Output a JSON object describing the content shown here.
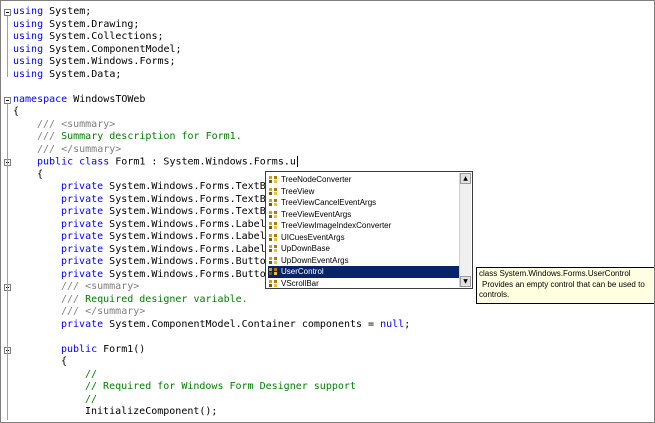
{
  "editor": {
    "lines": [
      [
        [
          "kw",
          "using"
        ],
        [
          "t",
          " System;"
        ]
      ],
      [
        [
          "kw",
          "using"
        ],
        [
          "t",
          " System.Drawing;"
        ]
      ],
      [
        [
          "kw",
          "using"
        ],
        [
          "t",
          " System.Collections;"
        ]
      ],
      [
        [
          "kw",
          "using"
        ],
        [
          "t",
          " System.ComponentModel;"
        ]
      ],
      [
        [
          "kw",
          "using"
        ],
        [
          "t",
          " System.Windows.Forms;"
        ]
      ],
      [
        [
          "kw",
          "using"
        ],
        [
          "t",
          " System.Data;"
        ]
      ],
      [],
      [
        [
          "kw",
          "namespace"
        ],
        [
          "t",
          " WindowsTOWeb"
        ]
      ],
      [
        [
          "t",
          "{"
        ]
      ],
      [
        [
          "doc",
          "/// <summary>"
        ]
      ],
      [
        [
          "doc",
          "/// "
        ],
        [
          "cm",
          "Summary description for Form1."
        ]
      ],
      [
        [
          "doc",
          "/// </summary>"
        ]
      ],
      [
        [
          "kw",
          "public class"
        ],
        [
          "t",
          " Form1 : System.Windows.Forms.u"
        ]
      ],
      [
        [
          "t",
          "{"
        ]
      ],
      [
        [
          "kw",
          "private"
        ],
        [
          "t",
          " System.Windows.Forms.TextBo"
        ]
      ],
      [
        [
          "kw",
          "private"
        ],
        [
          "t",
          " System.Windows.Forms.TextBo"
        ]
      ],
      [
        [
          "kw",
          "private"
        ],
        [
          "t",
          " System.Windows.Forms.TextBo"
        ]
      ],
      [
        [
          "kw",
          "private"
        ],
        [
          "t",
          " System.Windows.Forms.Label"
        ]
      ],
      [
        [
          "kw",
          "private"
        ],
        [
          "t",
          " System.Windows.Forms.Label"
        ]
      ],
      [
        [
          "kw",
          "private"
        ],
        [
          "t",
          " System.Windows.Forms.Label"
        ]
      ],
      [
        [
          "kw",
          "private"
        ],
        [
          "t",
          " System.Windows.Forms.Button"
        ]
      ],
      [
        [
          "kw",
          "private"
        ],
        [
          "t",
          " System.Windows.Forms.Button"
        ]
      ],
      [
        [
          "doc",
          "/// <summary>"
        ]
      ],
      [
        [
          "doc",
          "/// "
        ],
        [
          "cm",
          "Required designer variable."
        ]
      ],
      [
        [
          "doc",
          "/// </summary>"
        ]
      ],
      [
        [
          "kw",
          "private"
        ],
        [
          "t",
          " System.ComponentModel.Container components = "
        ],
        [
          "kw",
          "null"
        ],
        [
          "t",
          ";"
        ]
      ],
      [],
      [
        [
          "kw",
          "public"
        ],
        [
          "t",
          " Form1()"
        ]
      ],
      [
        [
          "t",
          "{"
        ]
      ],
      [
        [
          "cm",
          "//"
        ]
      ],
      [
        [
          "cm",
          "// Required for Windows Form Designer support"
        ]
      ],
      [
        [
          "cm",
          "//"
        ]
      ],
      [
        [
          "t",
          "InitializeComponent();"
        ]
      ]
    ],
    "indents": [
      0,
      0,
      0,
      0,
      0,
      0,
      0,
      0,
      0,
      1,
      1,
      1,
      1,
      1,
      2,
      2,
      2,
      2,
      2,
      2,
      2,
      2,
      2,
      2,
      2,
      2,
      0,
      2,
      2,
      3,
      3,
      3,
      3
    ]
  },
  "intellisense": {
    "items": [
      "TreeNodeConverter",
      "TreeView",
      "TreeViewCancelEventArgs",
      "TreeViewEventArgs",
      "TreeViewImageIndexConverter",
      "UICuesEventArgs",
      "UpDownBase",
      "UpDownEventArgs",
      "UserControl",
      "VScrollBar"
    ],
    "selected_index": 8,
    "scroll_up_glyph": "▲",
    "scroll_down_glyph": "▼",
    "item_icon": "class-icon"
  },
  "tooltip": {
    "signature": "class System.Windows.Forms.UserControl",
    "description": "Provides an empty control that can be used to",
    "description_cont": "controls."
  },
  "colors": {
    "keyword": "#0000ff",
    "comment": "#008000",
    "doc_comment": "#808080",
    "selection": "#0a246a",
    "tooltip_bg": "#ffffe1"
  }
}
